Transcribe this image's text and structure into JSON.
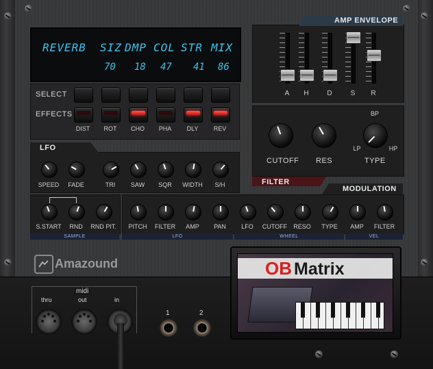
{
  "lcd": {
    "labels": [
      "REVERB",
      "SIZ",
      "DMP",
      "COL",
      "STR",
      "MIX"
    ],
    "values": [
      "70",
      "18",
      "47",
      "41",
      "86"
    ]
  },
  "rows": {
    "select": "SELECT",
    "effects": "EFFECTS"
  },
  "effects": {
    "items": [
      "DIST",
      "ROT",
      "CHO",
      "PHA",
      "DLY",
      "REV"
    ],
    "active": [
      false,
      false,
      true,
      false,
      true,
      true
    ]
  },
  "amp_envelope": {
    "title": "AMP ENVELOPE",
    "labels": [
      "A",
      "H",
      "D",
      "S",
      "R"
    ],
    "levels": [
      0.05,
      0.05,
      0.05,
      1.0,
      0.55
    ]
  },
  "filter": {
    "title": "FILTER",
    "cutoff": "CUTOFF",
    "res": "RES",
    "type": "TYPE",
    "bp": "BP",
    "lp": "LP",
    "hp": "HP"
  },
  "lfo": {
    "title": "LFO",
    "knobs": [
      "SPEED",
      "FADE",
      "TRI",
      "SAW",
      "SQR",
      "WIDTH",
      "S/H"
    ]
  },
  "modulation": {
    "title": "MODULATION",
    "sample_knobs": [
      "S.START",
      "RND",
      "RND PIT."
    ],
    "knobs": [
      "PITCH",
      "FILTER",
      "AMP",
      "PAN",
      "LFO",
      "CUTOFF",
      "RESO",
      "TYPE",
      "AMP",
      "FILTER"
    ],
    "sections": [
      "SAMPLE",
      "LFO",
      "WHEEL",
      "VEL"
    ]
  },
  "brand": {
    "name": "Amazound"
  },
  "cartridge": {
    "title_ob": "OB",
    "title_matrix": "Matrix"
  },
  "midi": {
    "title": "midi",
    "thru": "thru",
    "out": "out",
    "in": "in"
  },
  "audio_outputs": [
    "1",
    "2"
  ],
  "colors": {
    "lcd_text": "#39c6f0",
    "led_on": "#e02020",
    "section_strip": "#9bb6e8",
    "cartridge_red": "#d8201f"
  }
}
